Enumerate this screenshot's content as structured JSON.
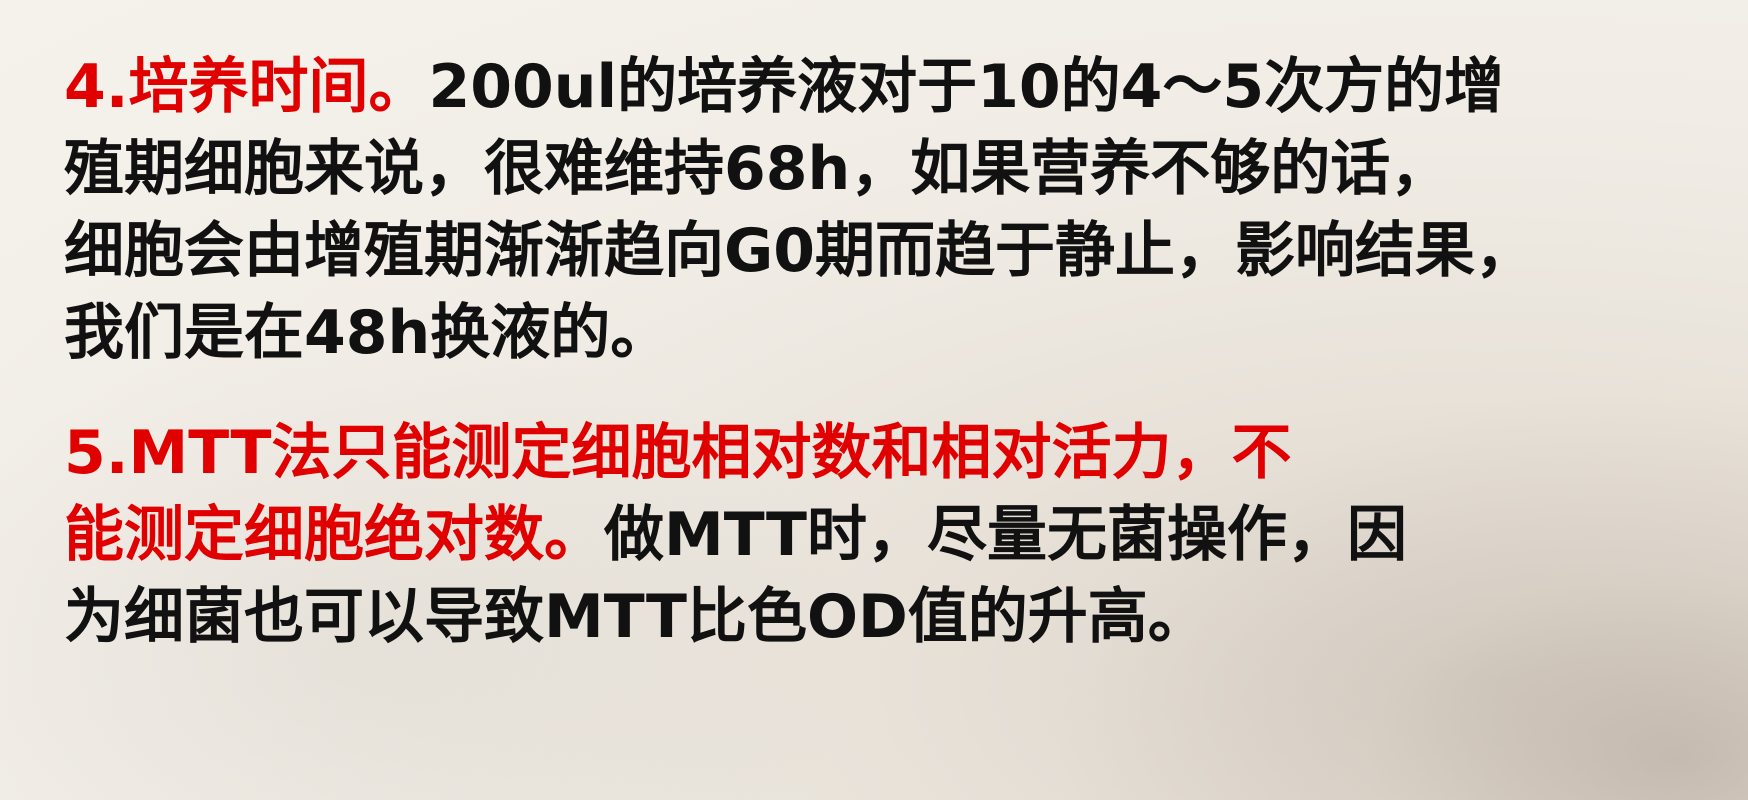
{
  "slide": {
    "para1": {
      "heading": "4.培养时间。",
      "line1_rest": "200ul的培养液对于10的4～5次方的增",
      "line2": "殖期细胞来说，很难维持68h，如果营养不够的话，",
      "line3": "细胞会由增殖期渐渐趋向G0期而趋于静止，影响结果，",
      "line4": "我们是在48h换液的。"
    },
    "para2": {
      "heading_line1": "5.MTT法只能测定细胞相对数和相对活力，不",
      "heading_line2": "能测定细胞绝对数。",
      "line2_rest": "做MTT时，尽量无菌操作，因",
      "line3": "为细菌也可以导致MTT比色OD值的升高。"
    },
    "colors": {
      "highlight": "#e10000",
      "text": "#111111"
    }
  }
}
